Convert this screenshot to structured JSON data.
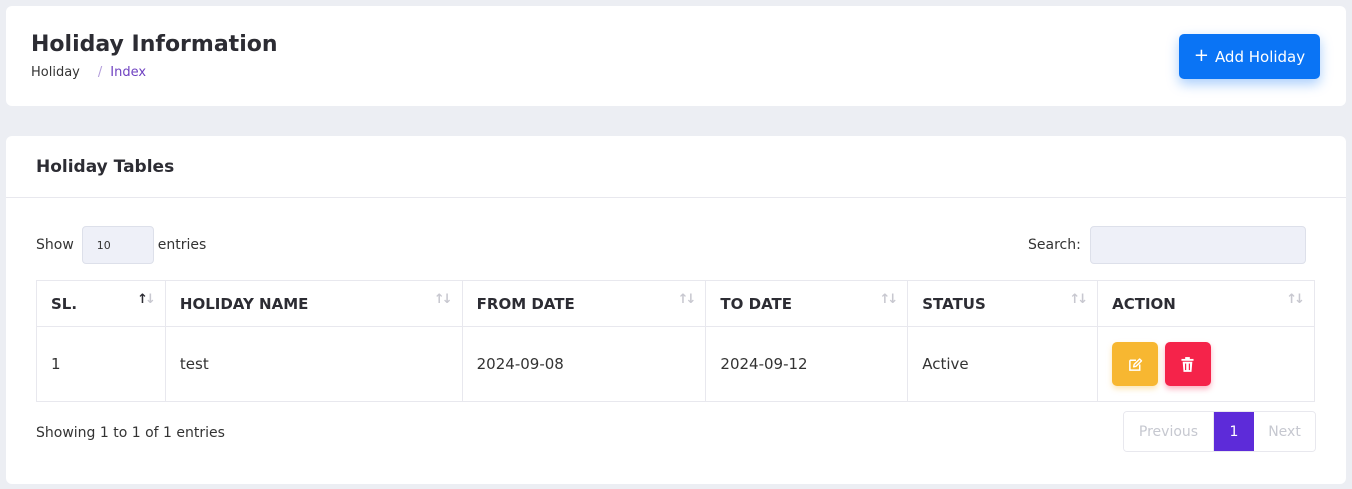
{
  "header": {
    "title": "Holiday Information",
    "breadcrumb": {
      "home": "Holiday",
      "separator": "/",
      "current": "Index"
    },
    "add_button": {
      "icon": "plus-icon",
      "label": "Add Holiday",
      "color": "#0a74f5"
    }
  },
  "card": {
    "title": "Holiday Tables",
    "length": {
      "prefix": "Show",
      "value": "10",
      "suffix": "entries"
    },
    "search": {
      "label": "Search:",
      "value": ""
    },
    "table": {
      "columns": [
        "SL.",
        "HOLIDAY NAME",
        "FROM DATE",
        "TO DATE",
        "STATUS",
        "ACTION"
      ],
      "rows": [
        {
          "sl": "1",
          "name": "test",
          "from": "2024-09-08",
          "to": "2024-09-12",
          "status": "Active"
        }
      ],
      "action_icons": {
        "edit": "edit-icon",
        "delete": "trash-icon"
      }
    },
    "info": "Showing 1 to 1 of 1 entries",
    "pagination": {
      "previous": "Previous",
      "current": "1",
      "next": "Next"
    }
  },
  "colors": {
    "accent": "#5d2bd9",
    "primary": "#0a74f5",
    "edit": "#f7b731",
    "delete": "#f5234a"
  }
}
